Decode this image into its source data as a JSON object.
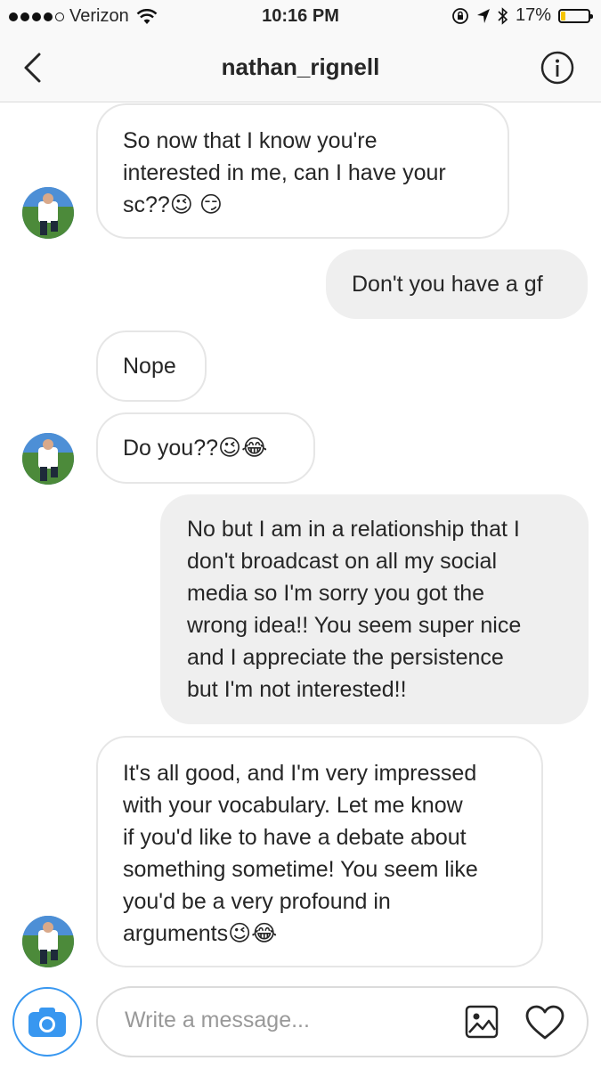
{
  "status": {
    "carrier": "Verizon",
    "time": "10:16 PM",
    "battery": "17%",
    "battery_level": 0.17
  },
  "header": {
    "title": "nathan_rignell"
  },
  "messages": [
    {
      "lines": [
        "So now that I know you're",
        "interested in me, can I have your",
        "sc??😉 😏"
      ]
    },
    {
      "lines": [
        "Don't you have a gf"
      ]
    },
    {
      "lines": [
        "Nope"
      ]
    },
    {
      "lines": [
        "Do you??😉😂"
      ]
    },
    {
      "lines": [
        "No but I am in a relationship that I",
        "don't broadcast on all my social",
        "media so I'm sorry you got the",
        "wrong idea!! You seem super nice",
        "and I appreciate the persistence",
        "but I'm not interested!!"
      ]
    },
    {
      "lines": [
        "It's all good, and I'm very impressed",
        "with your vocabulary. Let me know",
        "if you'd like to have a debate about",
        "something sometime! You seem like",
        "you'd be a very profound in",
        "arguments😉😂"
      ]
    }
  ],
  "composer": {
    "placeholder": "Write a message..."
  },
  "icons": {
    "back": "chevron-left-icon",
    "info": "info-icon",
    "camera": "camera-icon",
    "gallery": "image-icon",
    "like": "heart-icon"
  },
  "colors": {
    "accent": "#3897f0",
    "outgoing_bubble": "#efefef",
    "incoming_border": "#e6e6e6"
  }
}
